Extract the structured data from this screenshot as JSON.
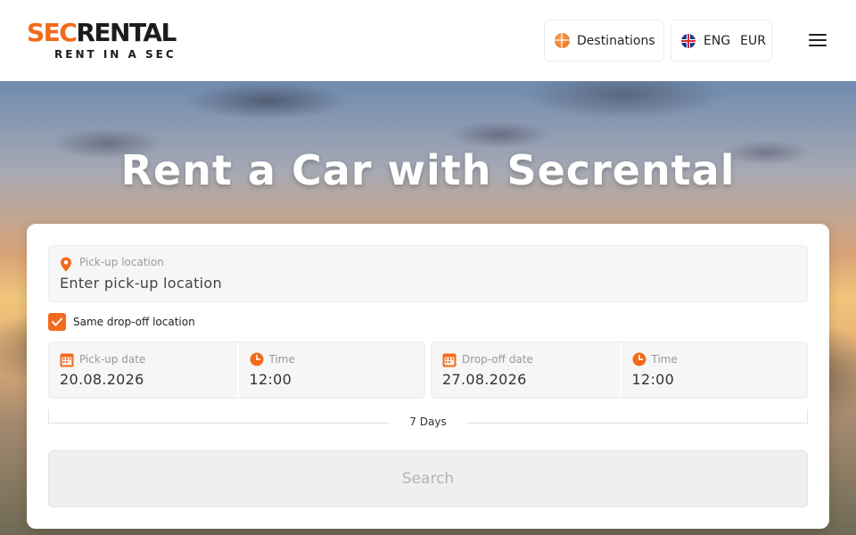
{
  "header": {
    "logo": {
      "word_a": "SEC",
      "word_b": "RENTAL",
      "tagline": "RENT IN A SEC"
    },
    "destinations_label": "Destinations",
    "language": "ENG",
    "currency": "EUR"
  },
  "hero": {
    "title": "Rent a Car with Secrental"
  },
  "search_form": {
    "pickup_location": {
      "label": "Pick-up location",
      "placeholder": "Enter pick-up location",
      "icon": "map-pin-icon"
    },
    "same_dropoff": {
      "label": "Same drop-off location",
      "checked": true
    },
    "pickup_date": {
      "label": "Pick-up date",
      "value": "20.08.2026",
      "icon": "calendar-icon"
    },
    "pickup_time": {
      "label": "Time",
      "value": "12:00",
      "icon": "clock-icon"
    },
    "dropoff_date": {
      "label": "Drop-off date",
      "value": "27.08.2026",
      "icon": "calendar-icon"
    },
    "dropoff_time": {
      "label": "Time",
      "value": "12:00",
      "icon": "clock-icon"
    },
    "duration": "7 Days",
    "search_button": "Search"
  },
  "colors": {
    "accent": "#f26a1b",
    "dark": "#1c1c1c",
    "field_bg": "#f6f6f6",
    "button_disabled_bg": "#efefef",
    "button_disabled_text": "#b5b5b5"
  }
}
